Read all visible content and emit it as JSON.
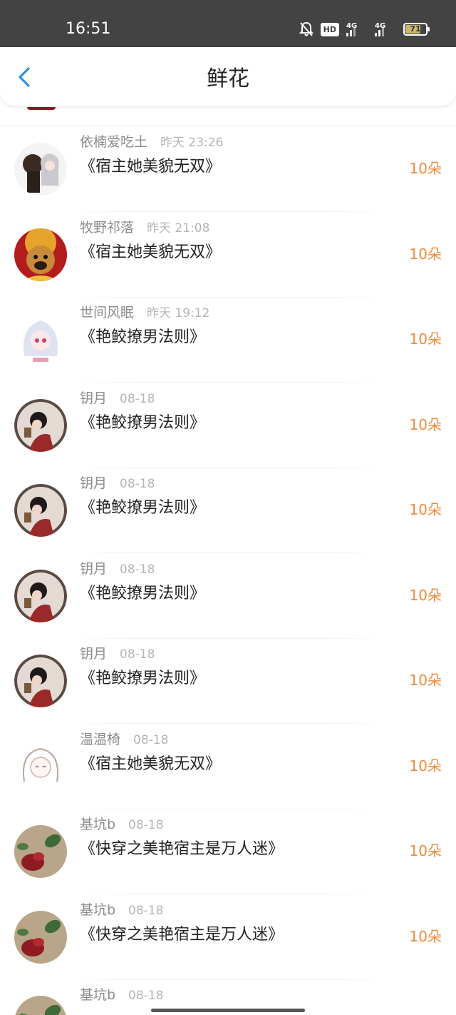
{
  "status_bar": {
    "time": "16:51",
    "hd_label": "HD",
    "net1": "4G",
    "net2": "4G",
    "battery": "71"
  },
  "header": {
    "title": "鲜花",
    "accent_color": "#2f8fe6"
  },
  "colors": {
    "amount": "#f08a3a",
    "name": "#8c8c8c",
    "time": "#b5b5b5"
  },
  "rows": [
    {
      "user": "依楠爱吃土",
      "time": "昨天 23:26",
      "book": "《宿主她美貌无双》",
      "amount": "10朵",
      "avatar": "anime-couple-avatar"
    },
    {
      "user": "牧野祁落",
      "time": "昨天 21:08",
      "book": "《宿主她美貌无双》",
      "amount": "10朵",
      "avatar": "dog-avatar"
    },
    {
      "user": "世间风眠",
      "time": "昨天 19:12",
      "book": "《艳鲛撩男法则》",
      "amount": "10朵",
      "avatar": "anime-girl-avatar"
    },
    {
      "user": "钥月",
      "time": "08-18",
      "book": "《艳鲛撩男法则》",
      "amount": "10朵",
      "avatar": "woman-portrait-avatar"
    },
    {
      "user": "钥月",
      "time": "08-18",
      "book": "《艳鲛撩男法则》",
      "amount": "10朵",
      "avatar": "woman-portrait-avatar"
    },
    {
      "user": "钥月",
      "time": "08-18",
      "book": "《艳鲛撩男法则》",
      "amount": "10朵",
      "avatar": "woman-portrait-avatar"
    },
    {
      "user": "钥月",
      "time": "08-18",
      "book": "《艳鲛撩男法则》",
      "amount": "10朵",
      "avatar": "woman-portrait-avatar"
    },
    {
      "user": "温温椅",
      "time": "08-18",
      "book": "《宿主她美貌无双》",
      "amount": "10朵",
      "avatar": "sketch-girl-avatar"
    },
    {
      "user": "基坑b",
      "time": "08-18",
      "book": "《快穿之美艳宿主是万人迷》",
      "amount": "10朵",
      "avatar": "rose-avatar"
    },
    {
      "user": "基坑b",
      "time": "08-18",
      "book": "《快穿之美艳宿主是万人迷》",
      "amount": "10朵",
      "avatar": "rose-avatar"
    },
    {
      "user": "基坑b",
      "time": "08-18",
      "book": "",
      "amount": "",
      "avatar": "rose-avatar"
    }
  ]
}
